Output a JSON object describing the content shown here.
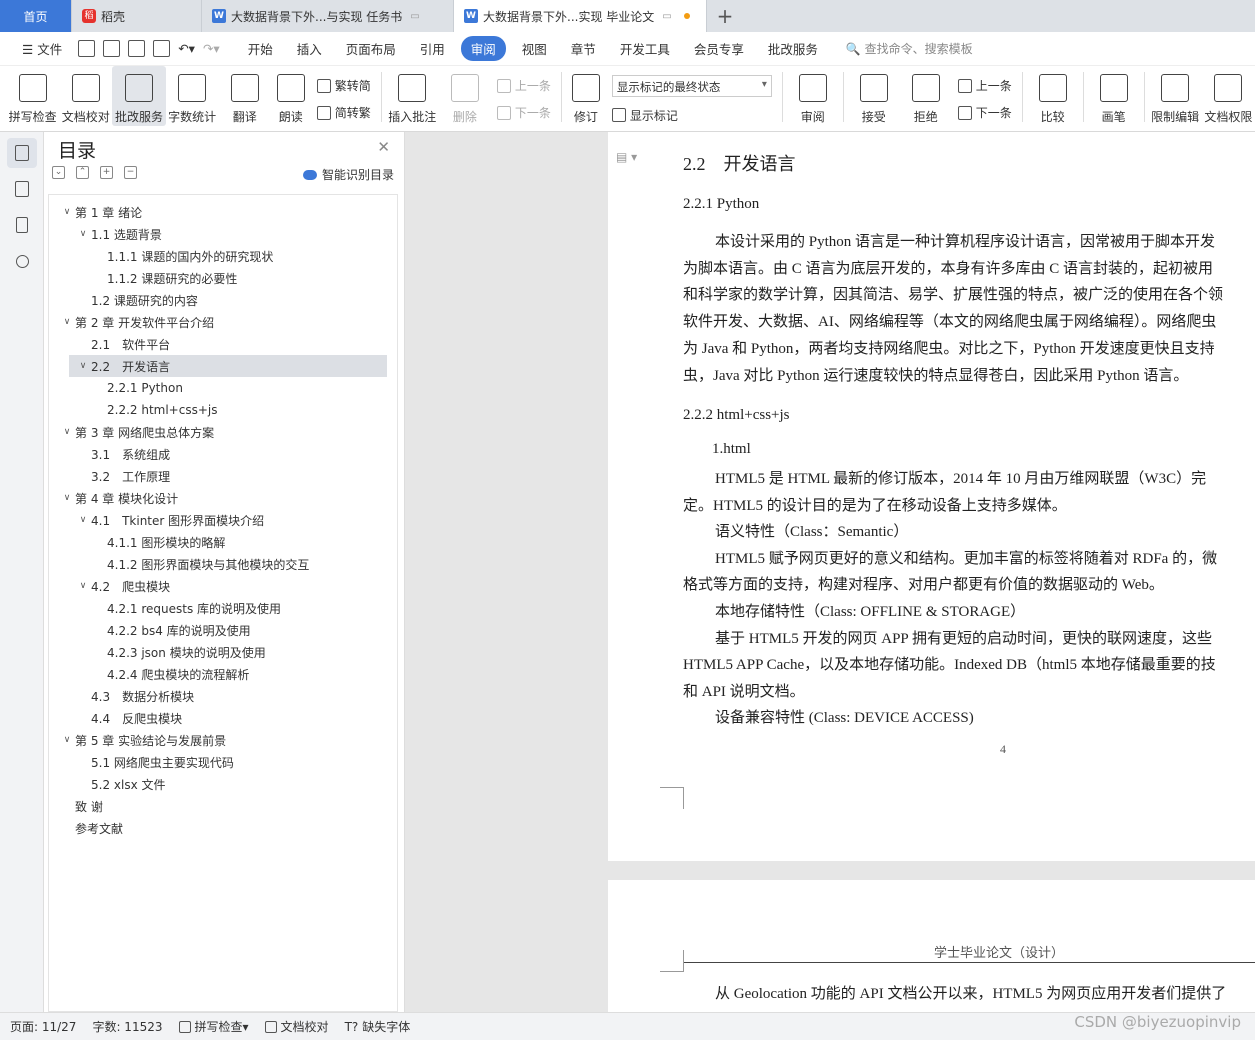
{
  "tabs": {
    "home": "首页",
    "daoke": "稻壳",
    "doc1": "大数据背景下外...与实现 任务书",
    "doc2": "大数据背景下外...实现 毕业论文",
    "plus": "+"
  },
  "menu": {
    "file": "文件",
    "items": [
      "开始",
      "插入",
      "页面布局",
      "引用",
      "审阅",
      "视图",
      "章节",
      "开发工具",
      "会员专享",
      "批改服务"
    ],
    "active_index": 4,
    "search": "查找命令、搜索模板"
  },
  "ribbon": {
    "spell": "拼写检查",
    "doccheck": "文档校对",
    "correct": "批改服务",
    "wordcount": "字数统计",
    "translate": "翻译",
    "read": "朗读",
    "trad": "繁转简",
    "simp": "简转繁",
    "insert_comment": "插入批注",
    "delete": "删除",
    "prev": "上一条",
    "next": "下一条",
    "revise": "修订",
    "markup_state": "显示标记的最终状态",
    "show_markup": "显示标记",
    "review": "审阅",
    "accept": "接受",
    "reject": "拒绝",
    "prev2": "上一条",
    "next2": "下一条",
    "compare": "比较",
    "pen": "画笔",
    "restrict": "限制编辑",
    "doc_perm": "文档权限"
  },
  "toc": {
    "title": "目录",
    "smart": "智能识别目录",
    "items": [
      {
        "text": "第 1 章 绪论",
        "level": 0,
        "arrow": "∨"
      },
      {
        "text": "1.1 选题背景",
        "level": 1,
        "arrow": "∨"
      },
      {
        "text": "1.1.1 课题的国内外的研究现状",
        "level": 2,
        "arrow": ""
      },
      {
        "text": "1.1.2 课题研究的必要性",
        "level": 2,
        "arrow": ""
      },
      {
        "text": "1.2 课题研究的内容",
        "level": 1,
        "arrow": ""
      },
      {
        "text": "第 2 章 开发软件平台介绍",
        "level": 0,
        "arrow": "∨"
      },
      {
        "text": "2.1　软件平台",
        "level": 1,
        "arrow": ""
      },
      {
        "text": "2.2　开发语言",
        "level": 1,
        "arrow": "∨",
        "selected": true
      },
      {
        "text": "2.2.1 Python",
        "level": 2,
        "arrow": ""
      },
      {
        "text": "2.2.2 html+css+js",
        "level": 2,
        "arrow": ""
      },
      {
        "text": "第 3 章 网络爬虫总体方案",
        "level": 0,
        "arrow": "∨"
      },
      {
        "text": "3.1　系统组成",
        "level": 1,
        "arrow": ""
      },
      {
        "text": "3.2　工作原理",
        "level": 1,
        "arrow": ""
      },
      {
        "text": "第 4 章 模块化设计",
        "level": 0,
        "arrow": "∨"
      },
      {
        "text": "4.1　Tkinter 图形界面模块介绍",
        "level": 1,
        "arrow": "∨"
      },
      {
        "text": "4.1.1 图形模块的略解",
        "level": 2,
        "arrow": ""
      },
      {
        "text": "4.1.2 图形界面模块与其他模块的交互",
        "level": 2,
        "arrow": ""
      },
      {
        "text": "4.2　爬虫模块",
        "level": 1,
        "arrow": "∨"
      },
      {
        "text": "4.2.1 requests 库的说明及使用",
        "level": 2,
        "arrow": ""
      },
      {
        "text": "4.2.2 bs4 库的说明及使用",
        "level": 2,
        "arrow": ""
      },
      {
        "text": "4.2.3 json 模块的说明及使用",
        "level": 2,
        "arrow": ""
      },
      {
        "text": "4.2.4 爬虫模块的流程解析",
        "level": 2,
        "arrow": ""
      },
      {
        "text": "4.3　数据分析模块",
        "level": 1,
        "arrow": ""
      },
      {
        "text": "4.4　反爬虫模块",
        "level": 1,
        "arrow": ""
      },
      {
        "text": "第 5 章 实验结论与发展前景",
        "level": 0,
        "arrow": "∨"
      },
      {
        "text": "5.1 网络爬虫主要实现代码",
        "level": 1,
        "arrow": ""
      },
      {
        "text": "5.2 xlsx 文件",
        "level": 1,
        "arrow": ""
      },
      {
        "text": "致  谢",
        "level": 0,
        "arrow": ""
      },
      {
        "text": "参考文献",
        "level": 0,
        "arrow": ""
      }
    ]
  },
  "doc": {
    "h22": "2.2　开发语言",
    "h221": "2.2.1 Python",
    "p1": [
      "本设计采用的 Python 语言是一种计算机程序设计语言，因常被用于脚本开发",
      "为脚本语言。由 C 语言为底层开发的，本身有许多库由 C 语言封装的，起初被用",
      "和科学家的数学计算，因其简洁、易学、扩展性强的特点，被广泛的使用在各个领",
      "软件开发、大数据、AI、网络编程等（本文的网络爬虫属于网络编程）。网络爬虫",
      "为 Java 和 Python，两者均支持网络爬虫。对比之下，Python 开发速度更快且支持",
      "虫，Java 对比 Python 运行速度较快的特点显得苍白，因此采用 Python 语言。"
    ],
    "h222": "2.2.2 html+css+js",
    "l1": "1.html",
    "p2": [
      "HTML5 是 HTML 最新的修订版本，2014 年 10 月由万维网联盟（W3C）完",
      "定。HTML5 的设计目的是为了在移动设备上支持多媒体。",
      "语义特性（Class：Semantic）",
      "HTML5 赋予网页更好的意义和结构。更加丰富的标签将随着对 RDFa 的，微",
      "格式等方面的支持，构建对程序、对用户都更有价值的数据驱动的 Web。",
      "本地存储特性（Class: OFFLINE & STORAGE）",
      "基于 HTML5 开发的网页 APP 拥有更短的启动时间，更快的联网速度，这些",
      "HTML5 APP Cache，以及本地存储功能。Indexed DB（html5 本地存储最重要的技",
      "和 API 说明文档。",
      "设备兼容特性 (Class: DEVICE ACCESS)"
    ],
    "page_num": "4",
    "header2": "学士毕业论文（设计）",
    "p3": "从 Geolocation 功能的 API 文档公开以来，HTML5 为网页应用开发者们提供了"
  },
  "status": {
    "page": "页面: 11/27",
    "words": "字数: 11523",
    "spell": "拼写检查",
    "check": "文档校对",
    "font": "缺失字体"
  },
  "watermark": "CSDN @biyezuopinvip",
  "colors": {
    "accent": "#3c78d8"
  }
}
